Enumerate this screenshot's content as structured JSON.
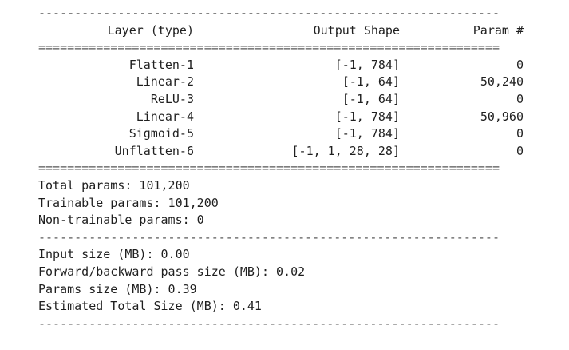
{
  "rules": {
    "dash": "----------------------------------------------------------------",
    "equals": "================================================================"
  },
  "header": {
    "layer": "Layer (type)",
    "output_shape": "Output Shape",
    "param": "Param #"
  },
  "layers": [
    {
      "name": "Flatten-1",
      "shape": "[-1, 784]",
      "params": "0"
    },
    {
      "name": "Linear-2",
      "shape": "[-1, 64]",
      "params": "50,240"
    },
    {
      "name": "ReLU-3",
      "shape": "[-1, 64]",
      "params": "0"
    },
    {
      "name": "Linear-4",
      "shape": "[-1, 784]",
      "params": "50,960"
    },
    {
      "name": "Sigmoid-5",
      "shape": "[-1, 784]",
      "params": "0"
    },
    {
      "name": "Unflatten-6",
      "shape": "[-1, 1, 28, 28]",
      "params": "0"
    }
  ],
  "totals": {
    "total": "Total params: 101,200",
    "trainable": "Trainable params: 101,200",
    "non_trainable": "Non-trainable params: 0"
  },
  "sizes": {
    "input": "Input size (MB): 0.00",
    "forward_backward": "Forward/backward pass size (MB): 0.02",
    "params": "Params size (MB): 0.39",
    "estimated_total": "Estimated Total Size (MB): 0.41"
  }
}
